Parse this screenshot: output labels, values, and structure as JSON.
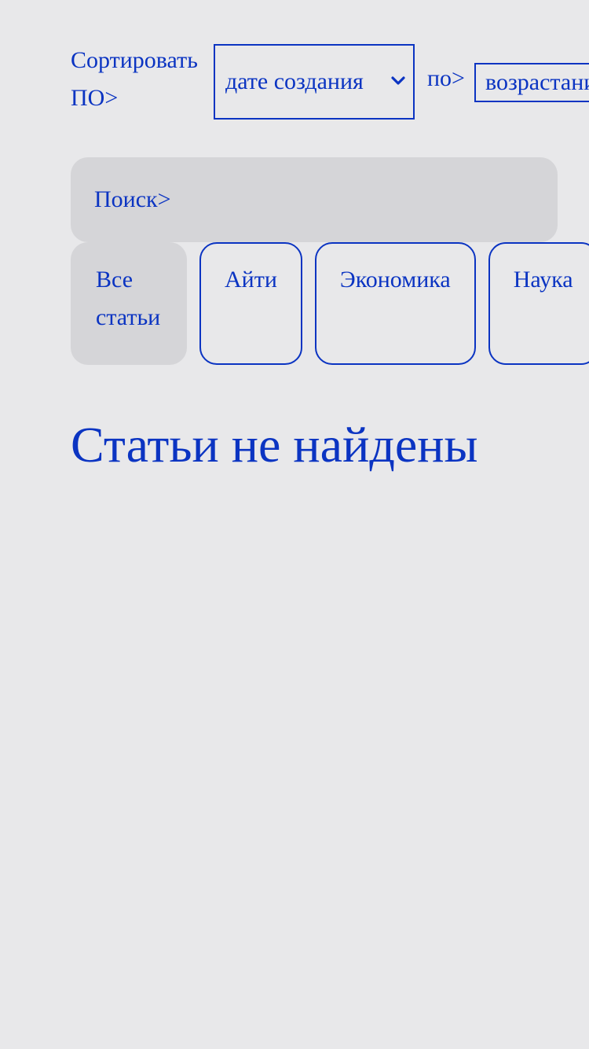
{
  "sort": {
    "label": "Сортировать ПО>",
    "field_value": "дате создания",
    "order_label": "по>",
    "order_value": "возрастанию"
  },
  "search": {
    "label": "Поиск>"
  },
  "tabs": [
    {
      "label": "Все статьи",
      "active": true
    },
    {
      "label": "Айти",
      "active": false
    },
    {
      "label": "Экономика",
      "active": false
    },
    {
      "label": "Наука",
      "active": false
    }
  ],
  "empty_state": {
    "message": "Статьи не найдены"
  },
  "colors": {
    "accent": "#0b34c2",
    "background": "#e8e8ea",
    "surface": "#d5d5d8"
  }
}
